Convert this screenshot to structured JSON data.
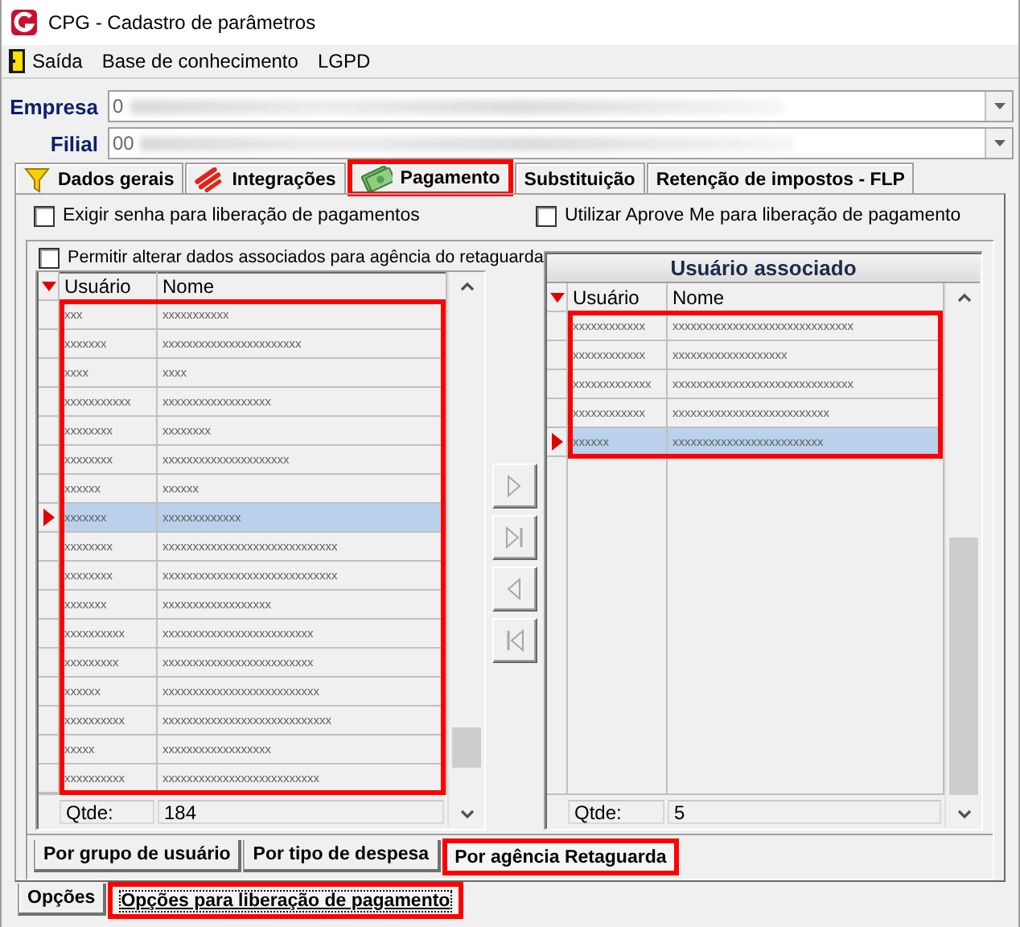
{
  "window": {
    "title": "CPG - Cadastro de parâmetros"
  },
  "menu": [
    {
      "label": "Saída",
      "kind": "exit"
    },
    {
      "label": "Base de conhecimento",
      "kind": "plain"
    },
    {
      "label": "LGPD",
      "kind": "plain"
    }
  ],
  "fields": [
    {
      "label": "Empresa",
      "value": "0"
    },
    {
      "label": "Filial",
      "value": "00"
    }
  ],
  "tabs": [
    {
      "label": "Dados gerais",
      "kind": "funnel",
      "selected": false,
      "highlighted": false
    },
    {
      "label": "Integrações",
      "kind": "stripes",
      "selected": false,
      "highlighted": false
    },
    {
      "label": "Pagamento",
      "kind": "money",
      "selected": true,
      "highlighted": true
    },
    {
      "label": "Substituição",
      "kind": "none",
      "selected": false,
      "highlighted": false
    },
    {
      "label": "Retenção de impostos - FLP",
      "kind": "none",
      "selected": false,
      "highlighted": false
    }
  ],
  "options": [
    {
      "label": "Exigir senha para liberação de pagamentos",
      "checked": false
    },
    {
      "label": "Utilizar Aprove Me para liberação de pagamento",
      "checked": false
    }
  ],
  "left_panel": {
    "checkbox": {
      "label": "Permitir alterar dados associados para agência do retaguarda",
      "checked": false
    },
    "grid": {
      "columns": [
        "Usuário",
        "Nome"
      ],
      "highlighted": true,
      "count_label": "Qtde:",
      "count": "184",
      "rows": [
        {
          "cells": [
            "xxx",
            "xxxxxxxxxxx"
          ],
          "selected": false
        },
        {
          "cells": [
            "xxxxxxx",
            "xxxxxxxxxxxxxxxxxxxxxxx"
          ],
          "selected": false
        },
        {
          "cells": [
            "xxxx",
            "xxxx"
          ],
          "selected": false
        },
        {
          "cells": [
            "xxxxxxxxxxx",
            "xxxxxxxxxxxxxxxxxx"
          ],
          "selected": false
        },
        {
          "cells": [
            "xxxxxxxx",
            "xxxxxxxx"
          ],
          "selected": false
        },
        {
          "cells": [
            "xxxxxxxx",
            "xxxxxxxxxxxxxxxxxxxxx"
          ],
          "selected": false
        },
        {
          "cells": [
            "xxxxxx",
            "xxxxxx"
          ],
          "selected": false
        },
        {
          "cells": [
            "xxxxxxx",
            "xxxxxxxxxxxxx"
          ],
          "selected": true
        },
        {
          "cells": [
            "xxxxxxxx",
            "xxxxxxxxxxxxxxxxxxxxxxxxxxxxx"
          ],
          "selected": false
        },
        {
          "cells": [
            "xxxxxxxx",
            "xxxxxxxxxxxxxxxxxxxxxxxxxxxxx"
          ],
          "selected": false
        },
        {
          "cells": [
            "xxxxxxx",
            "xxxxxxxxxxxxxxxxxx"
          ],
          "selected": false
        },
        {
          "cells": [
            "xxxxxxxxxx",
            "xxxxxxxxxxxxxxxxxxxxxxxxx"
          ],
          "selected": false
        },
        {
          "cells": [
            "xxxxxxxxx",
            "xxxxxxxxxxxxxxxxxxxxxxxxx"
          ],
          "selected": false
        },
        {
          "cells": [
            "xxxxxx",
            "xxxxxxxxxxxxxxxxxxxxxxxxxx"
          ],
          "selected": false
        },
        {
          "cells": [
            "xxxxxxxxxx",
            "xxxxxxxxxxxxxxxxxxxxxxxxxxxx"
          ],
          "selected": false
        },
        {
          "cells": [
            "xxxxx",
            "xxxxxxxxxxxxxxxxxx"
          ],
          "selected": false
        },
        {
          "cells": [
            "xxxxxxxxxx",
            "xxxxxxxxxxxxxxxxxxxxxxxxxx"
          ],
          "selected": false
        }
      ]
    }
  },
  "move_buttons": [
    {
      "kind": "add"
    },
    {
      "kind": "add_all"
    },
    {
      "kind": "remove"
    },
    {
      "kind": "remove_all"
    }
  ],
  "right_panel": {
    "title": "Usuário associado",
    "grid": {
      "columns": [
        "Usuário",
        "Nome"
      ],
      "highlighted": true,
      "count_label": "Qtde:",
      "count": "5",
      "rows": [
        {
          "cells": [
            "xxxxxxxxxxxx",
            "xxxxxxxxxxxxxxxxxxxxxxxxxxxxxx"
          ],
          "selected": false
        },
        {
          "cells": [
            "xxxxxxxxxxxx",
            "xxxxxxxxxxxxxxxxxxx"
          ],
          "selected": false
        },
        {
          "cells": [
            "xxxxxxxxxxxxx",
            "xxxxxxxxxxxxxxxxxxxxxxxxxxxxxx"
          ],
          "selected": false
        },
        {
          "cells": [
            "xxxxxxxxxxxx",
            "xxxxxxxxxxxxxxxxxxxxxxxxxx"
          ],
          "selected": false
        },
        {
          "cells": [
            "xxxxxx",
            "xxxxxxxxxxxxxxxxxxxxxxxxx"
          ],
          "selected": true
        }
      ]
    }
  },
  "group_tabs": [
    {
      "label": "Por grupo de usuário",
      "selected": false,
      "highlighted": false
    },
    {
      "label": "Por tipo de despesa",
      "selected": false,
      "highlighted": false
    },
    {
      "label": "Por agência Retaguarda",
      "selected": true,
      "highlighted": true
    }
  ],
  "bottom_tabs": [
    {
      "label": "Opções",
      "selected": false,
      "highlighted": false
    },
    {
      "label": "Opções para liberação de pagamento",
      "selected": true,
      "highlighted": true
    }
  ]
}
